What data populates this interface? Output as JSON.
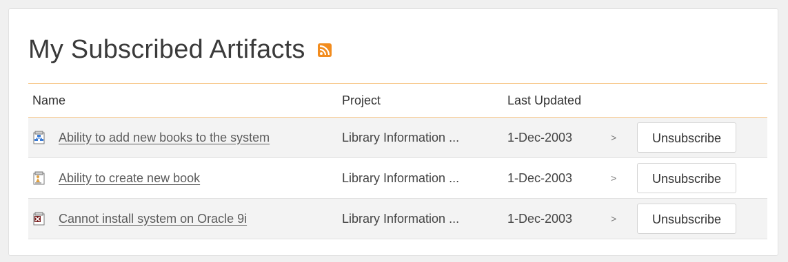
{
  "page": {
    "title": "My Subscribed Artifacts",
    "rss_icon": "rss-feed-icon"
  },
  "table": {
    "columns": [
      "Name",
      "Project",
      "Last Updated"
    ],
    "rows": [
      {
        "icon": "requirement-icon",
        "name": "Ability to add new books to the system",
        "project": "Library Information ...",
        "last_updated": "1-Dec-2003",
        "arrow": ">",
        "action": "Unsubscribe"
      },
      {
        "icon": "use-case-icon",
        "name": "Ability to create new book",
        "project": "Library Information ...",
        "last_updated": "1-Dec-2003",
        "arrow": ">",
        "action": "Unsubscribe"
      },
      {
        "icon": "incident-icon",
        "name": "Cannot install system on Oracle 9i",
        "project": "Library Information ...",
        "last_updated": "1-Dec-2003",
        "arrow": ">",
        "action": "Unsubscribe"
      }
    ]
  },
  "colors": {
    "header_border": "#f7c98c",
    "rss": "#f28c1e",
    "row_alt": "#f3f3f3"
  }
}
